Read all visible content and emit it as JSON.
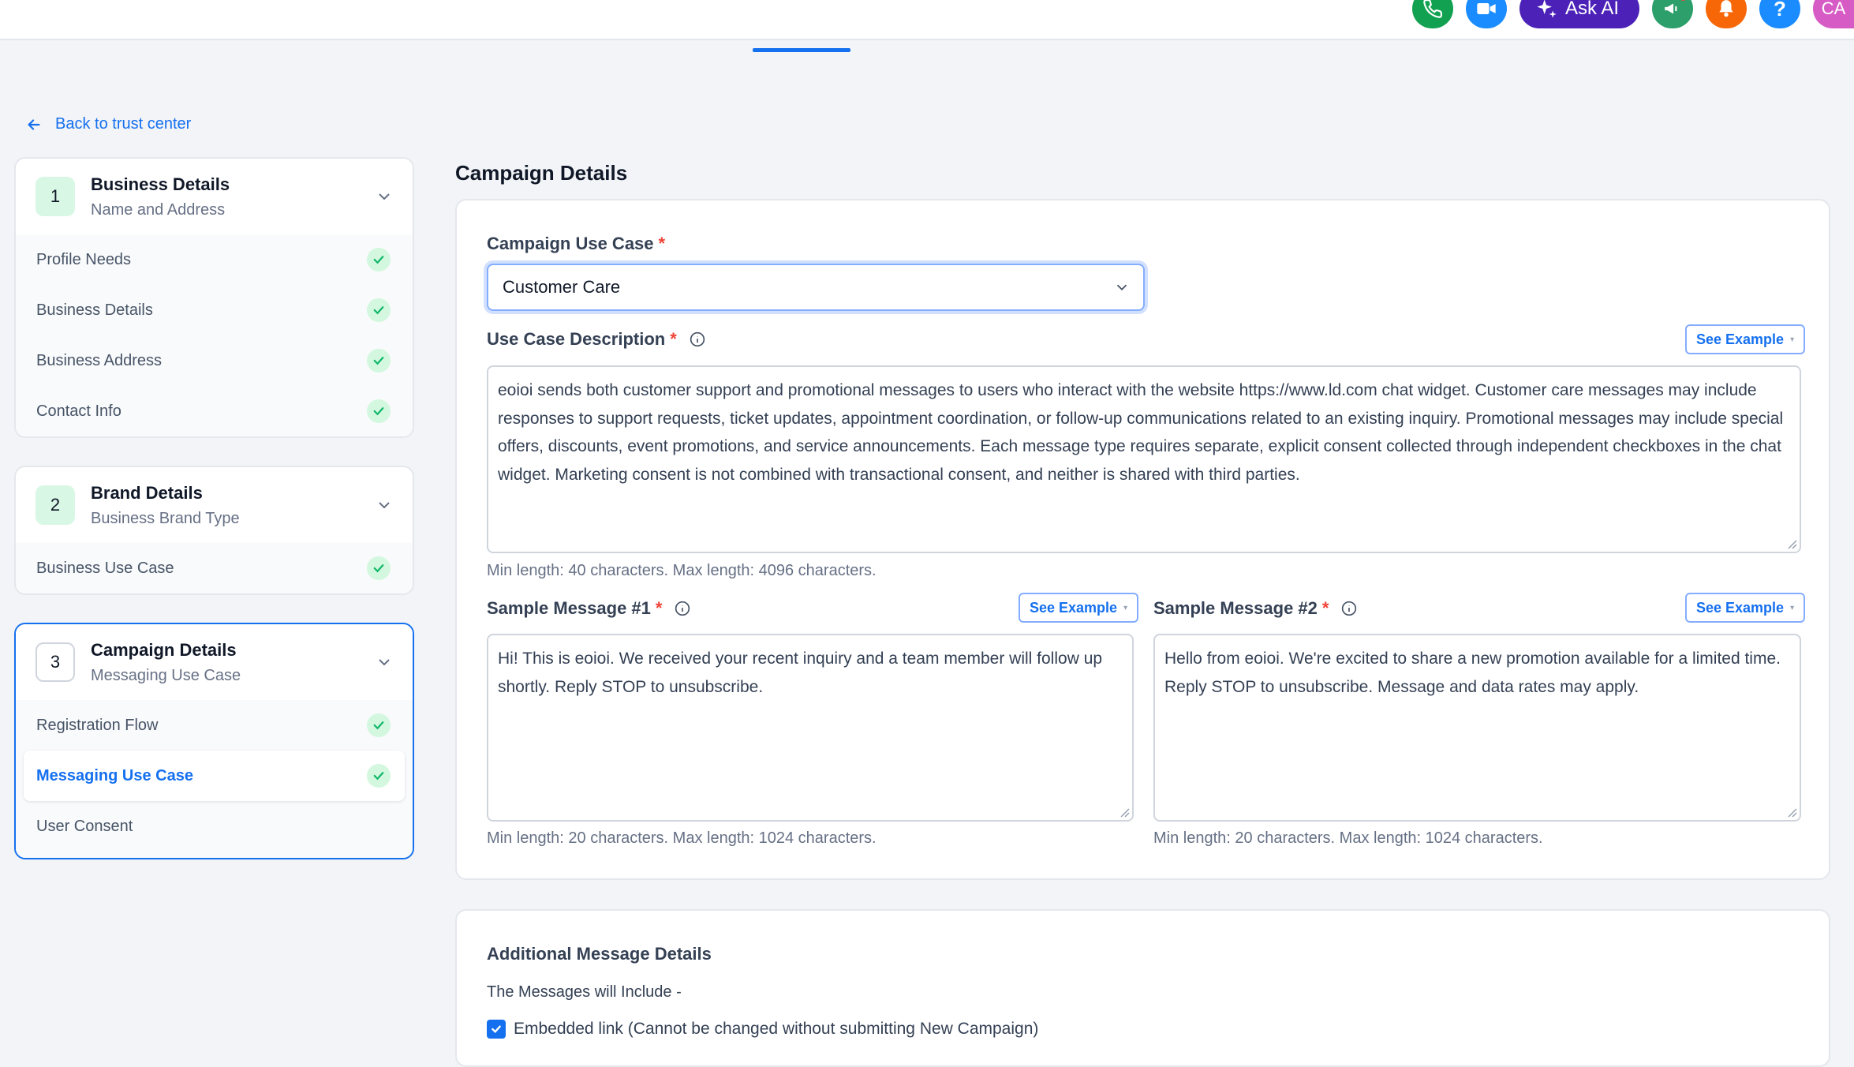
{
  "topbar": {
    "ask_ai_label": "Ask AI",
    "avatar_initials": "CA",
    "help_label": "?"
  },
  "back_link": "Back to trust center",
  "steps": [
    {
      "number": "1",
      "title": "Business Details",
      "subtitle": "Name and Address",
      "items": [
        "Profile Needs",
        "Business Details",
        "Business Address",
        "Contact Info"
      ]
    },
    {
      "number": "2",
      "title": "Brand Details",
      "subtitle": "Business Brand Type",
      "items": [
        "Business Use Case"
      ]
    },
    {
      "number": "3",
      "title": "Campaign Details",
      "subtitle": "Messaging Use Case",
      "items": [
        "Registration Flow",
        "Messaging Use Case",
        "User Consent"
      ]
    }
  ],
  "main": {
    "section_title": "Campaign Details",
    "campaign_use_case_label": "Campaign Use Case",
    "campaign_use_case_value": "Customer Care",
    "use_case_description_label": "Use Case Description",
    "use_case_description_value": "eoioi sends both customer support and promotional messages to users who interact with the website https://www.ld.com chat widget. Customer care messages may include responses to support requests, ticket updates, appointment coordination, or follow-up communications related to an existing inquiry. Promotional messages may include special offers, discounts, event promotions, and service announcements. Each message type requires separate, explicit consent collected through independent checkboxes in the chat widget. Marketing consent is not combined with transactional consent, and neither is shared with third parties.",
    "use_case_description_hint": "Min length: 40 characters. Max length: 4096 characters.",
    "see_example_label": "See Example",
    "sample1_label": "Sample Message #1",
    "sample1_value": "Hi! This is eoioi. We received your recent inquiry and a team member will follow up shortly. Reply STOP to unsubscribe.",
    "sample1_hint": "Min length: 20 characters. Max length: 1024 characters.",
    "sample2_label": "Sample Message #2",
    "sample2_value": "Hello from eoioi. We're excited to share a new promotion available for a limited time. Reply STOP to unsubscribe. Message and data rates may apply.",
    "sample2_hint": "Min length: 20 characters. Max length: 1024 characters.",
    "required_mark": "*"
  },
  "additional": {
    "title": "Additional Message Details",
    "intro": "The Messages will Include -",
    "embedded_link_label": "Embedded link (Cannot be changed without submitting New Campaign)",
    "embedded_link_checked": true
  },
  "colors": {
    "accent": "#1570ef",
    "success_bg": "#d3f8df",
    "success": "#12b76a",
    "ask_ai": "#4b21b7"
  }
}
